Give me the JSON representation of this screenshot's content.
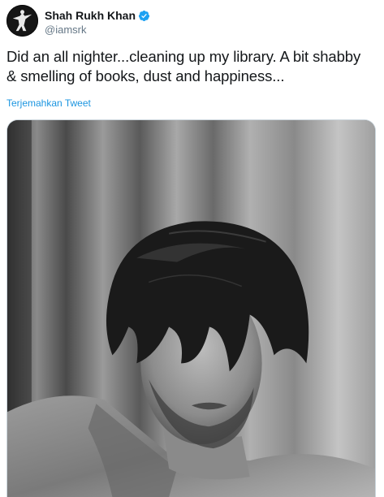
{
  "tweet": {
    "author": {
      "display_name": "Shah Rukh Khan",
      "handle": "@iamsrk",
      "verified": true,
      "verified_icon": "verified-badge-icon"
    },
    "text_line1": "Did an all nighter...cleaning up my library. A bit shabby",
    "text_line2": "& smelling of books, dust and happiness...",
    "translate_label": "Terjemahkan Tweet",
    "colors": {
      "link": "#1b95e0",
      "secondary_text": "#657786",
      "primary_text": "#14171a",
      "verified": "#1da1f2"
    }
  }
}
